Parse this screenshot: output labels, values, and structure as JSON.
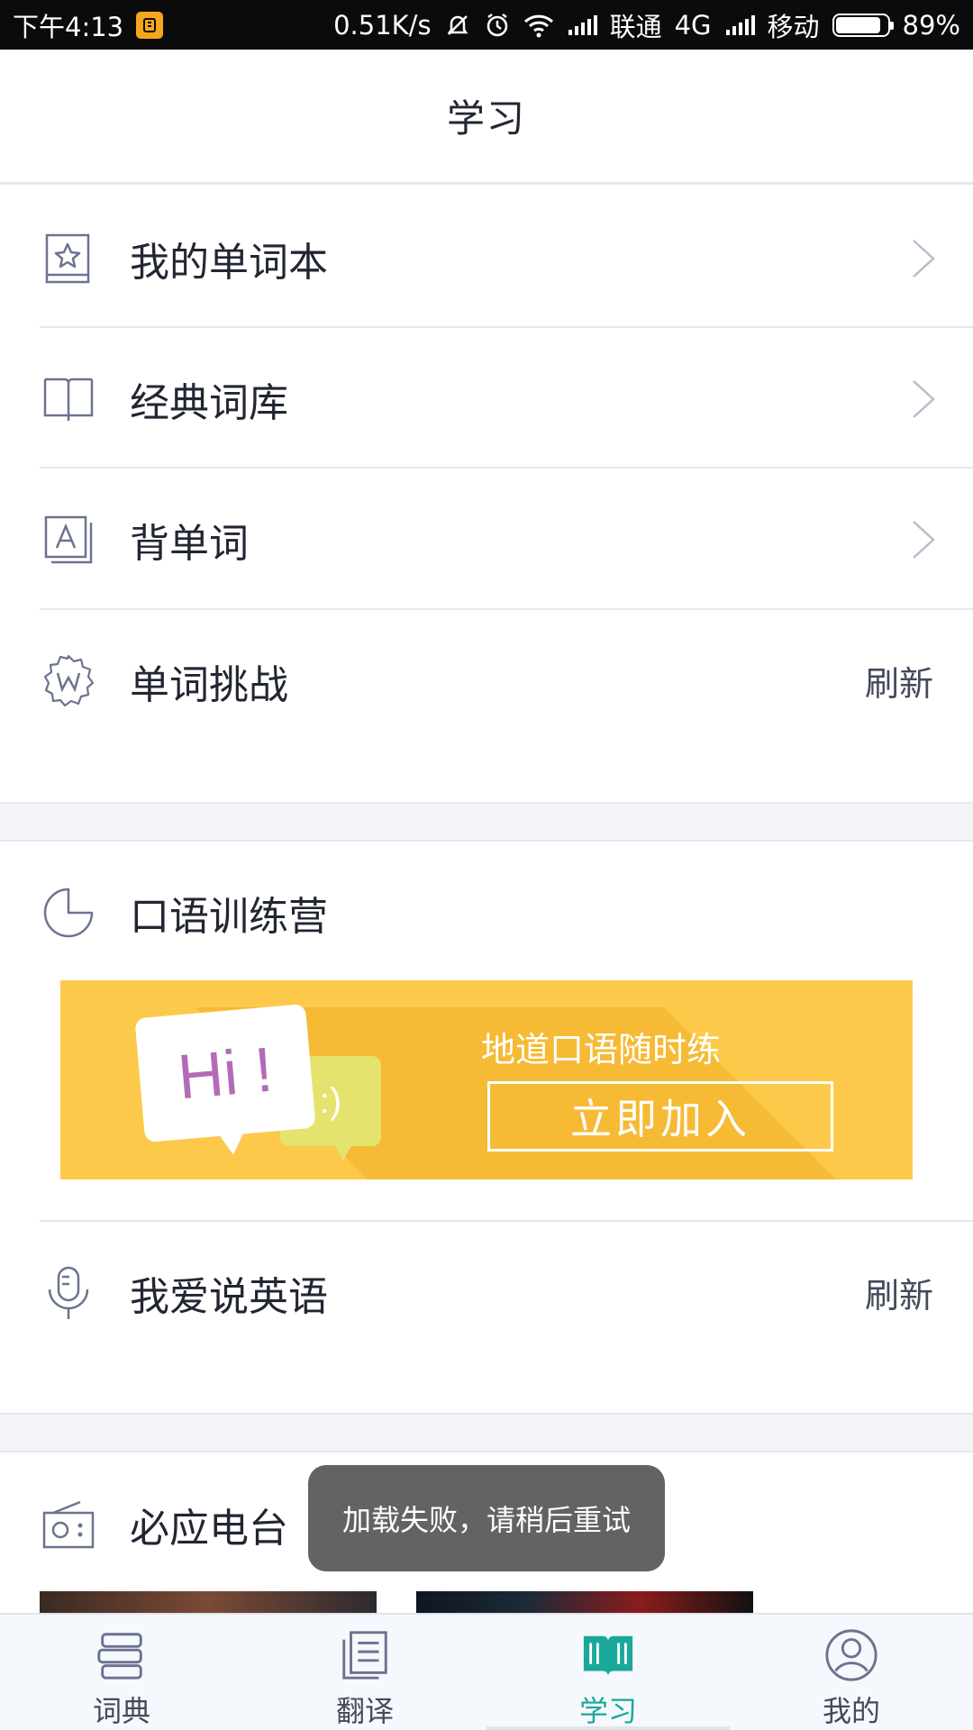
{
  "status_bar": {
    "time": "下午4:13",
    "speed": "0.51K/s",
    "carrier1": "联通",
    "network1": "4G",
    "carrier2": "移动",
    "battery": "89%",
    "battery_level": 0.89
  },
  "header": {
    "title": "学习"
  },
  "list": {
    "wordbook": "我的单词本",
    "classic": "经典词库",
    "memorize": "背单词",
    "challenge": "单词挑战",
    "challenge_action": "刷新"
  },
  "speaking": {
    "title": "口语训练营",
    "banner": {
      "hi_text": "Hi !",
      "smile_text": ":)",
      "tagline": "地道口语随时练",
      "join_label": "立即加入"
    },
    "love_english": "我爱说英语",
    "love_action": "刷新"
  },
  "radio": {
    "title": "必应电台"
  },
  "toast": "加载失败，请稍后重试",
  "tabs": [
    {
      "label": "词典",
      "icon": "dictionary-icon"
    },
    {
      "label": "翻译",
      "icon": "translate-icon"
    },
    {
      "label": "学习",
      "icon": "study-book-icon",
      "active": true
    },
    {
      "label": "我的",
      "icon": "profile-icon"
    }
  ],
  "colors": {
    "accent": "#1aa89b",
    "banner": "#fdc94b",
    "icon": "#6b7390"
  }
}
